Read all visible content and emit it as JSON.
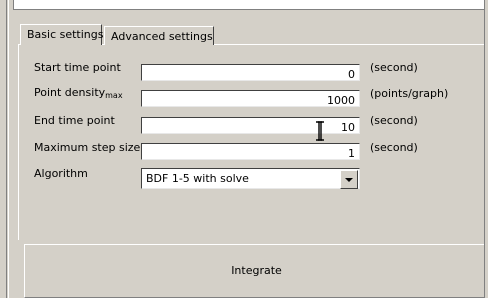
{
  "tabs": [
    {
      "label": "Basic settings",
      "active": true
    },
    {
      "label": "Advanced settings",
      "active": false
    }
  ],
  "fields": [
    {
      "label": "Start time point",
      "value": "0",
      "unit": "(second)"
    },
    {
      "label_main": "Point density",
      "label_sub": "max",
      "value": "1000",
      "unit": "(points/graph)"
    },
    {
      "label": "End time point",
      "value": "10",
      "unit": "(second)"
    },
    {
      "label": "Maximum step size",
      "value": "1",
      "unit": "(second)"
    }
  ],
  "algorithm": {
    "label": "Algorithm",
    "selected": "BDF 1-5 with solve"
  },
  "integrate_button": "Integrate",
  "colors": {
    "background": "#d4d0c8",
    "field": "#ffffff",
    "shadow": "#404040"
  },
  "icons": [
    "text-cursor-icon",
    "dropdown-arrow-icon"
  ]
}
